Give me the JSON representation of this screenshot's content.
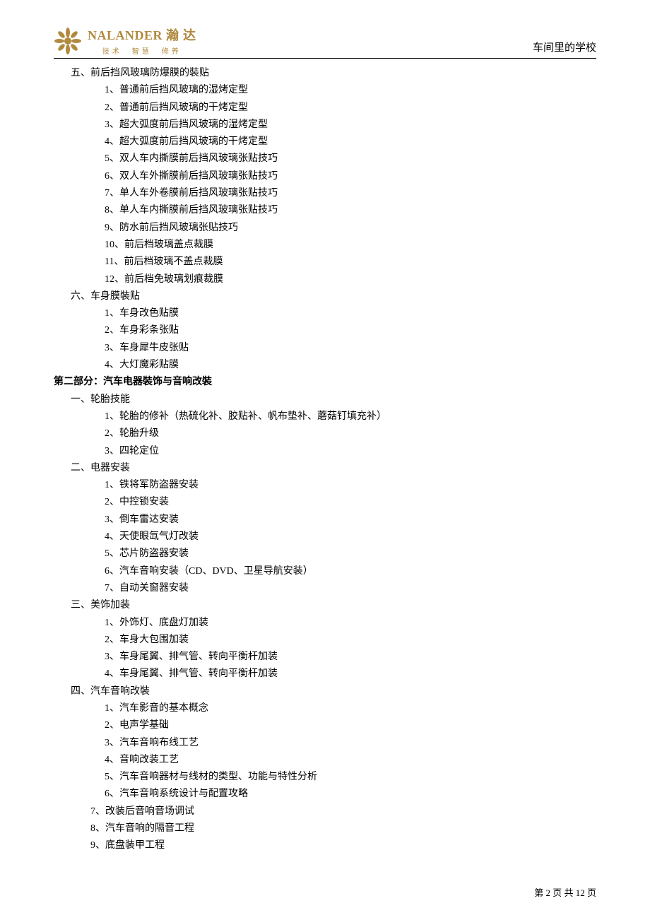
{
  "header": {
    "brand_en": "NALANDER",
    "brand_cn": "瀚 达",
    "tagline": "技术　智慧　修养",
    "right_text": "车间里的学校"
  },
  "sections": {
    "s5": {
      "title": "五、前后挡风玻璃防爆膜的裝贴",
      "items": [
        "1、普通前后挡风玻璃的湿烤定型",
        "2、普通前后挡风玻璃的干烤定型",
        "3、超大弧度前后挡风玻璃的湿烤定型",
        "4、超大弧度前后挡风玻璃的干烤定型",
        "5、双人车内撕膜前后挡风玻璃张贴技巧",
        "6、双人车外撕膜前后挡风玻璃张贴技巧",
        "7、单人车外卷膜前后挡风玻璃张贴技巧",
        "8、单人车内撕膜前后挡风玻璃张贴技巧",
        "9、防水前后挡风玻璃张贴技巧",
        "10、前后档玻璃盖点裁膜",
        "11、前后档玻璃不盖点裁膜",
        "12、前后档免玻璃划痕裁膜"
      ]
    },
    "s6": {
      "title": "六、车身膜裝贴",
      "items": [
        "1、车身改色贴膜",
        "2、车身彩条张贴",
        "3、车身犀牛皮张贴",
        "4、大灯魔彩贴膜"
      ]
    },
    "part2": {
      "title": "第二部分：汽车电器裝饰与音响改裝"
    },
    "p2_1": {
      "title": "一、轮胎技能",
      "items": [
        "1、轮胎的修补（热硫化补、胶贴补、帆布垫补、蘑菇钉填充补）",
        "2、轮胎升级",
        "3、四轮定位"
      ]
    },
    "p2_2": {
      "title": "二、电器安装",
      "items": [
        "1、铁将军防盗器安装",
        "2、中控锁安装",
        "3、倒车雷达安装",
        "4、天使眼氙气灯改装",
        "5、芯片防盗器安装",
        "6、汽车音响安装（CD、DVD、卫星导航安装）",
        "7、自动关窗器安装"
      ]
    },
    "p2_3": {
      "title": "三、美饰加装",
      "items": [
        "1、外饰灯、底盘灯加装",
        "2、车身大包围加装",
        "3、车身尾翼、排气管、转向平衡杆加装",
        "4、车身尾翼、排气管、转向平衡杆加装"
      ]
    },
    "p2_4": {
      "title": "四、汽车音响改裝",
      "items_a": [
        "1、汽车影音的基本概念",
        "2、电声学基础",
        "3、汽车音响布线工艺",
        "4、音响改装工艺",
        "5、汽车音响器材与线材的类型、功能与特性分析",
        "6、汽车音响系统设计与配置攻略"
      ],
      "items_b": [
        "7、改装后音响音场调试",
        "8、汽车音响的隔音工程",
        "9、底盘装甲工程"
      ]
    }
  },
  "footer": {
    "text": "第 2 页 共 12 页"
  }
}
